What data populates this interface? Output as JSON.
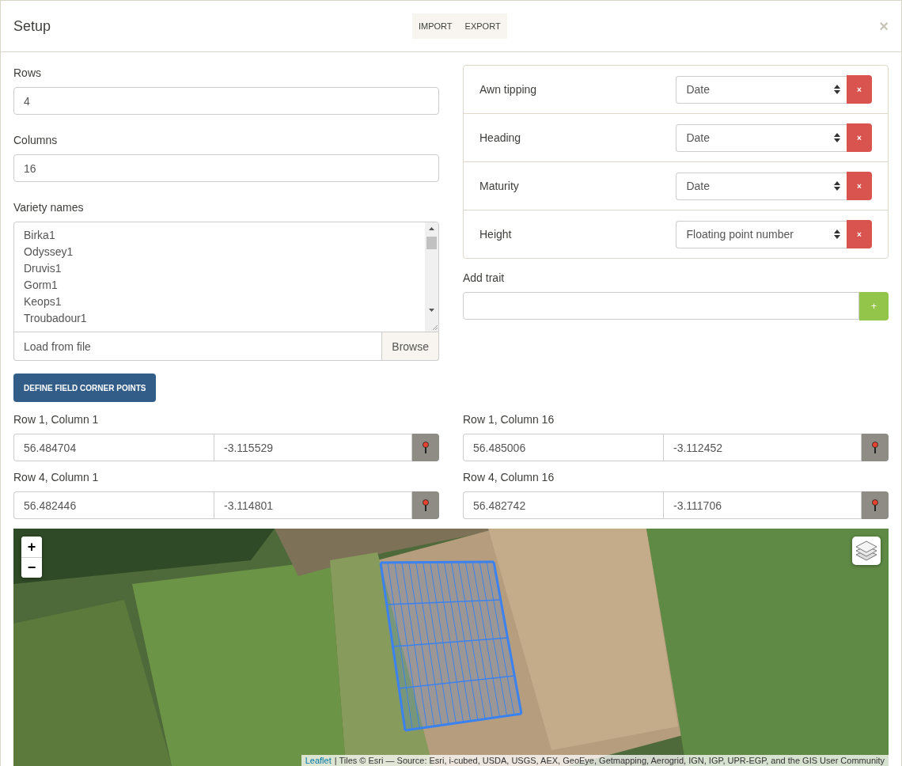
{
  "window": {
    "title": "Setup",
    "close": "×"
  },
  "header_buttons": [
    "IMPORT",
    "EXPORT"
  ],
  "rows_field": {
    "label": "Rows",
    "value": "4"
  },
  "columns_field": {
    "label": "Columns",
    "value": "16"
  },
  "variety_names": {
    "label": "Variety names",
    "lines": [
      "Birka1",
      "Odyssey1",
      "Druvis1",
      "Gorm1",
      "Keops1",
      "Troubadour1"
    ]
  },
  "load_file": {
    "placeholder": "Load from file",
    "button": "Browse"
  },
  "traits": [
    {
      "name": "Awn tipping",
      "type": "Date",
      "remove": "×"
    },
    {
      "name": "Heading",
      "type": "Date",
      "remove": "×"
    },
    {
      "name": "Maturity",
      "type": "Date",
      "remove": "×"
    },
    {
      "name": "Height",
      "type": "Floating point number",
      "remove": "×"
    }
  ],
  "add_trait": {
    "label": "Add trait",
    "button": "+"
  },
  "define_button": "DEFINE FIELD CORNER POINTS",
  "corners": [
    {
      "label": "Row 1, Column 1",
      "lat": "56.484704",
      "lon": "-3.115529"
    },
    {
      "label": "Row 1, Column 16",
      "lat": "56.485006",
      "lon": "-3.112452"
    },
    {
      "label": "Row 4, Column 1",
      "lat": "56.482446",
      "lon": "-3.114801"
    },
    {
      "label": "Row 4, Column 16",
      "lat": "56.482742",
      "lon": "-3.111706"
    }
  ],
  "map": {
    "zoom_in": "+",
    "zoom_out": "−",
    "attribution_link": "Leaflet",
    "attribution": "| Tiles © Esri — Source: Esri, i-cubed, USDA, USGS, AEX, GeoEye, Getmapping, Aerogrid, IGN, IGP, UPR-EGP, and the GIS User Community"
  }
}
